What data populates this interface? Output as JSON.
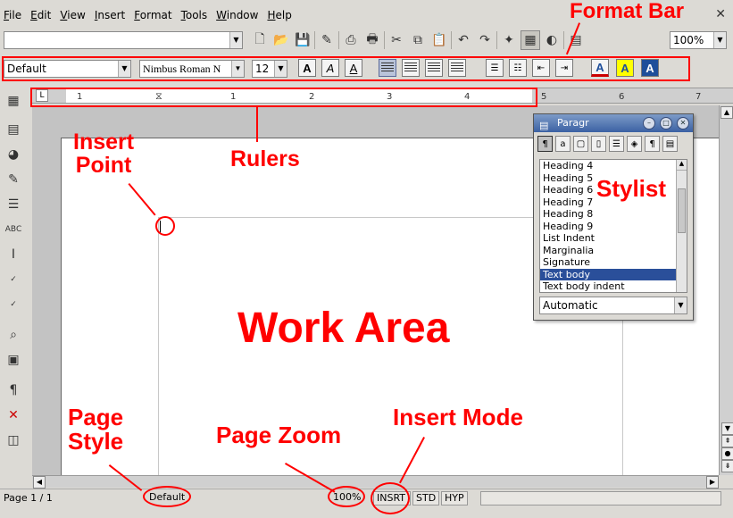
{
  "menubar": {
    "items": [
      "File",
      "Edit",
      "View",
      "Insert",
      "Format",
      "Tools",
      "Window",
      "Help"
    ],
    "close_glyph": "✕"
  },
  "function_bar": {
    "url_value": "",
    "zoom_value": "100%",
    "icons": [
      "document-icon",
      "open-folder-icon",
      "save-icon",
      "edit-file-icon",
      "export-pdf-icon",
      "print-icon",
      "cut-icon",
      "copy-icon",
      "paste-icon",
      "undo-icon",
      "redo-icon",
      "navigator-icon",
      "stylist-toggle-icon",
      "gallery-icon",
      "chart-icon"
    ]
  },
  "format_bar": {
    "paragraph_style": "Default",
    "font_name": "Nimbus Roman N",
    "font_size": "12",
    "effect_glyphs": [
      "A",
      "A",
      "A"
    ],
    "color_glyphs": [
      "A",
      "A",
      "A"
    ],
    "colors": {
      "font_color": "#cc0000",
      "highlight": "#ffff00",
      "background": "#1e4e9a"
    }
  },
  "ruler": {
    "numbers": [
      "1",
      "1",
      "2",
      "3",
      "4",
      "5",
      "6",
      "7"
    ]
  },
  "stylist": {
    "title": "Paragr",
    "items": [
      "Heading 4",
      "Heading 5",
      "Heading 6",
      "Heading 7",
      "Heading 8",
      "Heading 9",
      "List Indent",
      "Marginalia",
      "Signature",
      "Text body",
      "Text body indent"
    ],
    "selected": "Text body",
    "filter": "Automatic"
  },
  "statusbar": {
    "page": "Page 1 / 1",
    "page_style": "Default",
    "zoom": "100%",
    "insert_mode": "INSRT",
    "selection_mode": "STD",
    "hyperlink_mode": "HYP"
  },
  "annotations": {
    "format_bar": "Format Bar",
    "insert_point": "Insert\nPoint",
    "rulers": "Rulers",
    "stylist": "Stylist",
    "work_area": "Work Area",
    "page_style": "Page\nStyle",
    "page_zoom": "Page Zoom",
    "insert_mode": "Insert Mode",
    "color": "#ff0000"
  }
}
